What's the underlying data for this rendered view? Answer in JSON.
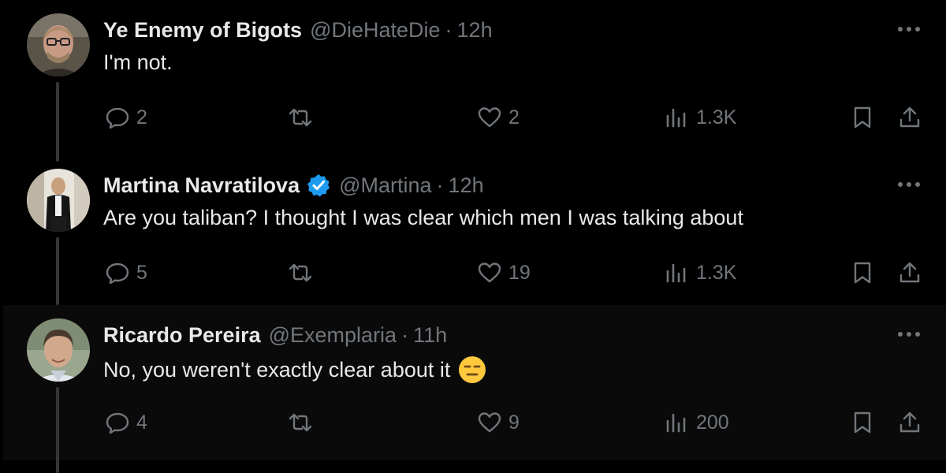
{
  "tweets": [
    {
      "name": "Ye Enemy of Bigots",
      "handle": "@DieHateDie",
      "separator": "·",
      "time": "12h",
      "text": "I'm not.",
      "verified": false,
      "replies": "2",
      "retweets": "",
      "likes": "2",
      "views": "1.3K"
    },
    {
      "name": "Martina Navratilova",
      "handle": "@Martina",
      "separator": "·",
      "time": "12h",
      "text": "Are you taliban? I thought I was clear which men I was talking about",
      "verified": true,
      "replies": "5",
      "retweets": "",
      "likes": "19",
      "views": "1.3K"
    },
    {
      "name": "Ricardo Pereira",
      "handle": "@Exemplaria",
      "separator": "·",
      "time": "11h",
      "text": "No, you weren't exactly clear about it",
      "emoji": "expressionless-face-emoji",
      "verified": false,
      "replies": "4",
      "retweets": "",
      "likes": "9",
      "views": "200"
    }
  ],
  "icons": {
    "reply": "speech-bubble-icon",
    "retweet": "retweet-arrows-icon",
    "like": "heart-icon",
    "views": "bar-chart-icon",
    "bookmark": "bookmark-icon",
    "share": "share-upload-icon",
    "more": "more-dots-icon",
    "verified": "verified-badge-icon"
  },
  "colors": {
    "background": "#000000",
    "highlight_background": "#0a0a0a",
    "primary_text": "#e7e9ea",
    "secondary_text": "#71767b",
    "verified_blue": "#1d9bf0",
    "thread_line": "#333639"
  }
}
